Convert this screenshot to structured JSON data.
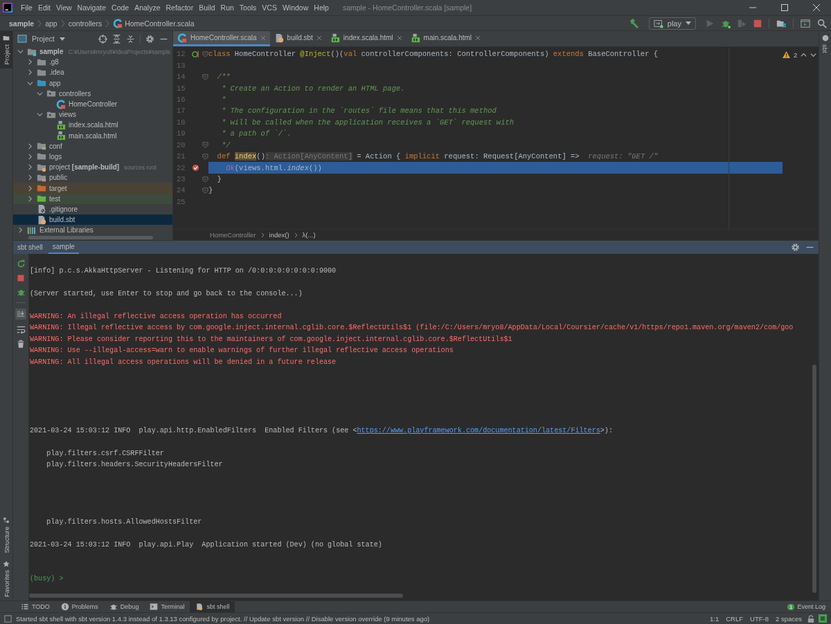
{
  "title_bar": {
    "menus": [
      "File",
      "Edit",
      "View",
      "Navigate",
      "Code",
      "Analyze",
      "Refactor",
      "Build",
      "Run",
      "Tools",
      "VCS",
      "Window",
      "Help"
    ],
    "title": "sample - HomeController.scala [sample]"
  },
  "nav_bar": {
    "breadcrumb": [
      {
        "label": "sample",
        "kind": "project"
      },
      {
        "label": "app",
        "kind": "folder"
      },
      {
        "label": "controllers",
        "kind": "folder"
      },
      {
        "label": "HomeController.scala",
        "kind": "scala-file"
      }
    ],
    "run_config": "play"
  },
  "left_stripe": [
    {
      "label": "Project",
      "selected": true,
      "kind": "project"
    },
    {
      "label": "Structure",
      "selected": false,
      "kind": "structure"
    },
    {
      "label": "Favorites",
      "selected": false,
      "kind": "favorites"
    }
  ],
  "project_panel": {
    "title": "Project",
    "tree": [
      {
        "label": "sample",
        "note": "C:¥Users¥mryo8¥IdeaProjects¥sample",
        "kind": "module",
        "expanded": true,
        "selected": false,
        "children": [
          {
            "label": ".g8",
            "kind": "folder",
            "expanded": false,
            "selected": false
          },
          {
            "label": ".idea",
            "kind": "folder",
            "expanded": false,
            "selected": false
          },
          {
            "label": "app",
            "kind": "source-folder",
            "expanded": true,
            "selected": false,
            "children": [
              {
                "label": "controllers",
                "kind": "package",
                "expanded": true,
                "selected": false,
                "children": [
                  {
                    "label": "HomeController",
                    "kind": "scala-class",
                    "selected": false
                  }
                ]
              },
              {
                "label": "views",
                "kind": "package",
                "expanded": true,
                "selected": false,
                "children": [
                  {
                    "label": "index.scala.html",
                    "kind": "html",
                    "selected": false
                  },
                  {
                    "label": "main.scala.html",
                    "kind": "html",
                    "selected": false
                  }
                ]
              }
            ]
          },
          {
            "label": "conf",
            "kind": "resource-folder",
            "expanded": false,
            "selected": false
          },
          {
            "label": "logs",
            "kind": "folder",
            "expanded": false,
            "selected": false
          },
          {
            "label": "project **[sample-build]**",
            "note": "sources root",
            "kind": "module-folder",
            "expanded": false,
            "selected": false
          },
          {
            "label": "public",
            "kind": "resource-folder",
            "expanded": false,
            "selected": false
          },
          {
            "label": "target",
            "kind": "excluded-folder",
            "expanded": false,
            "selected": false
          },
          {
            "label": "test",
            "kind": "test-folder",
            "expanded": false,
            "selected": false
          },
          {
            "label": ".gitignore",
            "kind": "ignore-file",
            "selected": false
          },
          {
            "label": "build.sbt",
            "kind": "sbt-file",
            "selected": true
          }
        ]
      },
      {
        "label": "External Libraries",
        "kind": "libraries",
        "expanded": false,
        "selected": false
      }
    ]
  },
  "editor": {
    "tabs": [
      {
        "label": "HomeController.scala",
        "kind": "scala-class",
        "selected": true
      },
      {
        "label": "build.sbt",
        "kind": "sbt-file",
        "selected": false
      },
      {
        "label": "index.scala.html",
        "kind": "html",
        "selected": false
      },
      {
        "label": "main.scala.html",
        "kind": "html",
        "selected": false
      }
    ],
    "warnings": "2",
    "lines": [
      {
        "number": "12",
        "marker": {
          "kind": "implements"
        },
        "fold": true,
        "tokens": [
          {
            "text": "class",
            "kind": "keyword"
          },
          {
            "text": " HomeController ",
            "kind": "plain"
          },
          {
            "text": "@Inject",
            "kind": "annotation"
          },
          {
            "text": "()(",
            "kind": "plain"
          },
          {
            "text": "val",
            "kind": "keyword"
          },
          {
            "text": " controllerComponents: ControllerComponents) ",
            "kind": "plain"
          },
          {
            "text": "extends",
            "kind": "keyword"
          },
          {
            "text": " BaseController {",
            "kind": "plain"
          }
        ]
      },
      {
        "number": "13"
      },
      {
        "number": "14",
        "fold": true,
        "tokens": [
          {
            "text": "  /**",
            "kind": "comment"
          }
        ]
      },
      {
        "number": "15",
        "tokens": [
          {
            "text": "   * Create an Action to render an HTML page.",
            "kind": "comment"
          }
        ]
      },
      {
        "number": "16",
        "tokens": [
          {
            "text": "   *",
            "kind": "comment"
          }
        ]
      },
      {
        "number": "17",
        "tokens": [
          {
            "text": "   * The configuration in the `routes` file means that this method",
            "kind": "comment"
          }
        ]
      },
      {
        "number": "18",
        "tokens": [
          {
            "text": "   * will be called when the application receives a `GET` request with",
            "kind": "comment"
          }
        ]
      },
      {
        "number": "19",
        "tokens": [
          {
            "text": "   * a path of `/`.",
            "kind": "comment"
          }
        ]
      },
      {
        "number": "20",
        "fold": true,
        "tokens": [
          {
            "text": "   */",
            "kind": "comment"
          }
        ]
      },
      {
        "number": "21",
        "fold": true,
        "tokens": [
          {
            "text": "  def ",
            "kind": "keyword"
          },
          {
            "text": "index",
            "kind": "usage"
          },
          {
            "text": "()",
            "kind": "plain"
          },
          {
            "text": ": Action[AnyContent]",
            "kind": "hint"
          },
          {
            "text": " = Action { ",
            "kind": "plain"
          },
          {
            "text": "implicit",
            "kind": "keyword"
          },
          {
            "text": " request: Request[AnyContent] =>  ",
            "kind": "plain"
          },
          {
            "text": "request: \"GET /\"",
            "kind": "inline-value"
          }
        ]
      },
      {
        "number": "22",
        "marker": {
          "kind": "breakpoint"
        },
        "current": true,
        "tokens": [
          {
            "text": "    Ok",
            "kind": "call"
          },
          {
            "text": "(views.html.",
            "kind": "plain"
          },
          {
            "text": "index",
            "kind": "italic"
          },
          {
            "text": "())",
            "kind": "plain"
          }
        ]
      },
      {
        "number": "23",
        "fold": true,
        "tokens": [
          {
            "text": "  }",
            "kind": "plain"
          }
        ]
      },
      {
        "number": "24",
        "fold": true,
        "tokens": [
          {
            "text": "}",
            "kind": "plain"
          }
        ]
      },
      {
        "number": "25"
      }
    ],
    "breadcrumb": [
      "HomeController",
      "index()",
      "λ(...)"
    ]
  },
  "right_stripe": [
    {
      "label": "sbt",
      "selected": false
    }
  ],
  "sbt_window": {
    "title": "sbt shell",
    "tabs": [
      {
        "label": "sample",
        "selected": true
      }
    ],
    "lines": [
      {
        "kind": "blank"
      },
      {
        "kind": "text",
        "segments": [
          {
            "text": "[info] p.c.s.AkkaHttpServer - Listening for HTTP on /0:0:0:0:0:0:0:0:9000",
            "kind": "plain"
          }
        ]
      },
      {
        "kind": "blank"
      },
      {
        "kind": "text",
        "segments": [
          {
            "text": "(Server started, use Enter to stop and go back to the console...)",
            "kind": "plain"
          }
        ]
      },
      {
        "kind": "blank"
      },
      {
        "kind": "text",
        "segments": [
          {
            "text": "WARNING: An illegal reflective access operation has occurred",
            "kind": "warning"
          }
        ]
      },
      {
        "kind": "text",
        "segments": [
          {
            "text": "WARNING: Illegal reflective access by com.google.inject.internal.cglib.core.$ReflectUtils$1 (file:/C:/Users/mryo8/AppData/Local/Coursier/cache/v1/https/repo1.maven.org/maven2/com/goo",
            "kind": "warning"
          }
        ]
      },
      {
        "kind": "text",
        "segments": [
          {
            "text": "WARNING: Please consider reporting this to the maintainers of com.google.inject.internal.cglib.core.$ReflectUtils$1",
            "kind": "warning"
          }
        ]
      },
      {
        "kind": "text",
        "segments": [
          {
            "text": "WARNING: Use --illegal-access=warn to enable warnings of further illegal reflective access operations",
            "kind": "warning"
          }
        ]
      },
      {
        "kind": "text",
        "segments": [
          {
            "text": "WARNING: All illegal access operations will be denied in a future release",
            "kind": "warning"
          }
        ]
      },
      {
        "kind": "blank"
      },
      {
        "kind": "blank"
      },
      {
        "kind": "blank"
      },
      {
        "kind": "blank"
      },
      {
        "kind": "blank"
      },
      {
        "kind": "text",
        "segments": [
          {
            "text": "2021-03-24 15:03:12 INFO  play.api.http.EnabledFilters  Enabled Filters (see <",
            "kind": "plain"
          },
          {
            "text": "https://www.playframework.com/documentation/latest/Filters",
            "kind": "link"
          },
          {
            "text": ">):",
            "kind": "plain"
          }
        ]
      },
      {
        "kind": "blank"
      },
      {
        "kind": "text",
        "segments": [
          {
            "text": "    play.filters.csrf.CSRFFilter",
            "kind": "plain"
          }
        ]
      },
      {
        "kind": "text",
        "segments": [
          {
            "text": "    play.filters.headers.SecurityHeadersFilter",
            "kind": "plain"
          }
        ]
      },
      {
        "kind": "blank"
      },
      {
        "kind": "blank"
      },
      {
        "kind": "blank"
      },
      {
        "kind": "blank"
      },
      {
        "kind": "text",
        "segments": [
          {
            "text": "    play.filters.hosts.AllowedHostsFilter",
            "kind": "plain"
          }
        ]
      },
      {
        "kind": "blank"
      },
      {
        "kind": "text",
        "segments": [
          {
            "text": "2021-03-24 15:03:12 INFO  play.api.Play  Application started (Dev) (no global state)",
            "kind": "plain"
          }
        ]
      },
      {
        "kind": "blank"
      },
      {
        "kind": "blank"
      },
      {
        "kind": "text",
        "segments": [
          {
            "text": "(busy) >",
            "kind": "prompt"
          }
        ]
      }
    ]
  },
  "tool_tabs": [
    {
      "label": "TODO",
      "kind": "todo",
      "selected": false
    },
    {
      "label": "Problems",
      "kind": "problems",
      "selected": false
    },
    {
      "label": "Debug",
      "kind": "debug",
      "selected": false
    },
    {
      "label": "Terminal",
      "kind": "terminal",
      "selected": false
    },
    {
      "label": "sbt shell",
      "kind": "sbt",
      "selected": true
    }
  ],
  "event_log": {
    "label": "Event Log",
    "count": "1"
  },
  "status_bar": {
    "message": "Started sbt shell with sbt version 1.4.3 instead of 1.3.13 configured by project. // Update sbt version // Disable version override (9 minutes ago)",
    "items": [
      "1:1",
      "CRLF",
      "UTF-8",
      "2 spaces"
    ]
  }
}
